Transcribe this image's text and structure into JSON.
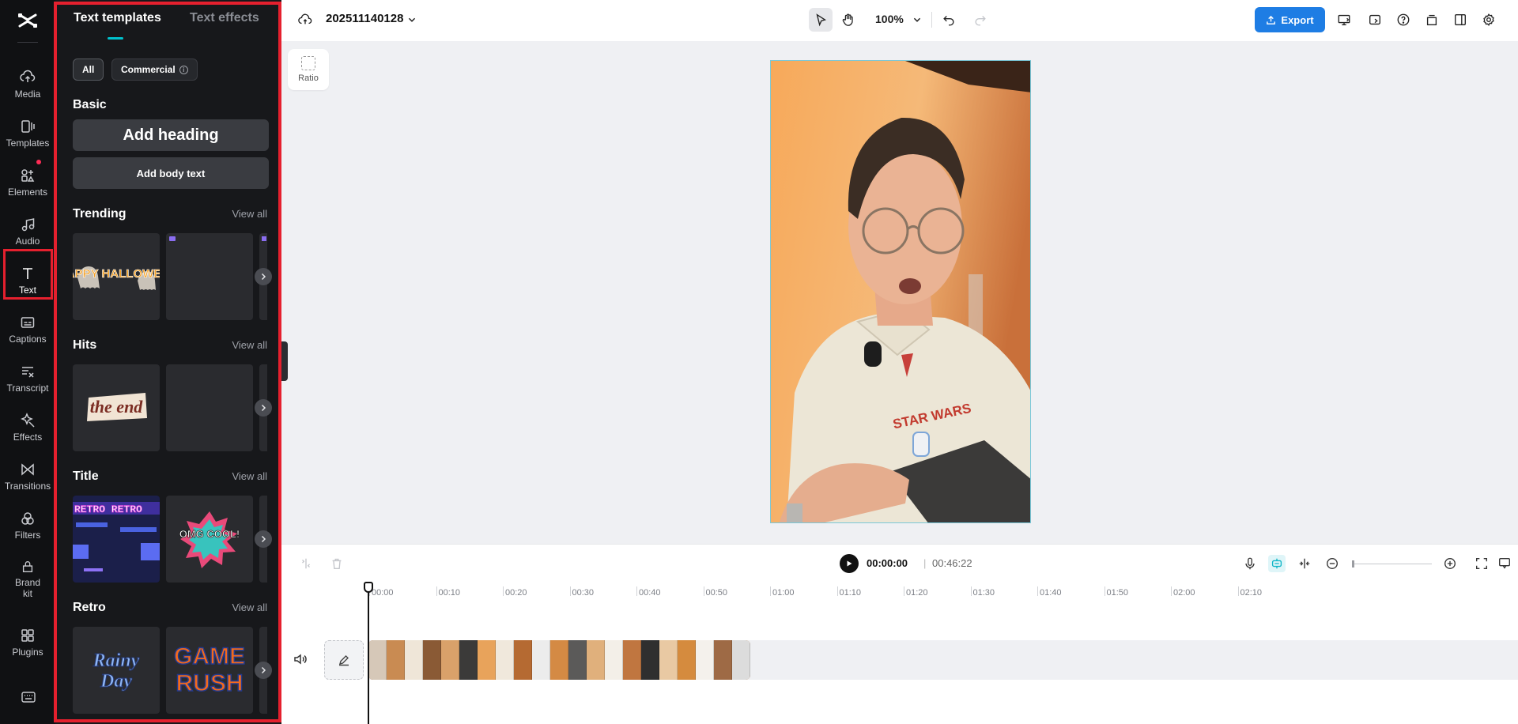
{
  "rail": {
    "items": [
      {
        "label": "Media",
        "icon": "cloud-upload-icon"
      },
      {
        "label": "Templates",
        "icon": "templates-icon"
      },
      {
        "label": "Elements",
        "icon": "elements-icon"
      },
      {
        "label": "Audio",
        "icon": "music-note-icon"
      },
      {
        "label": "Text",
        "icon": "text-icon"
      },
      {
        "label": "Captions",
        "icon": "captions-icon"
      },
      {
        "label": "Transcript",
        "icon": "transcript-icon"
      },
      {
        "label": "Effects",
        "icon": "effects-icon"
      },
      {
        "label": "Transitions",
        "icon": "transitions-icon"
      },
      {
        "label": "Filters",
        "icon": "filters-icon"
      },
      {
        "label": "Brand kit",
        "icon": "brand-kit-icon"
      },
      {
        "label": "Plugins",
        "icon": "plugins-icon"
      }
    ],
    "active": "Text",
    "active_highlight_color": "#e5202e"
  },
  "panel": {
    "tabs": [
      {
        "label": "Text templates"
      },
      {
        "label": "Text effects"
      }
    ],
    "filters": {
      "all": "All",
      "commercial": "Commercial"
    },
    "basic": {
      "title": "Basic",
      "add_heading": "Add heading",
      "add_body": "Add body text"
    },
    "sections": [
      {
        "title": "Trending",
        "view_all": "View all",
        "cards": [
          "HAPPY HALLOWEEN",
          ""
        ]
      },
      {
        "title": "Hits",
        "view_all": "View all",
        "cards": [
          "the end",
          ""
        ]
      },
      {
        "title": "Title",
        "view_all": "View all",
        "cards": [
          "RETRO RETRO",
          "OMG COOL!"
        ]
      },
      {
        "title": "Retro",
        "view_all": "View all",
        "cards": [
          "Rainy Day",
          "GAME RUSH"
        ]
      }
    ]
  },
  "topbar": {
    "project_name": "202511140128",
    "zoom": "100%",
    "export_label": "Export",
    "accent_color": "#1e7de4"
  },
  "canvas": {
    "ratio_label": "Ratio",
    "video_text": "STAR WARS"
  },
  "timeline": {
    "current_time": "00:00:00",
    "separator": "|",
    "total_time": "00:46:22",
    "ruler": [
      "00:00",
      "00:10",
      "00:20",
      "00:30",
      "00:40",
      "00:50",
      "01:00",
      "01:10",
      "01:20",
      "01:30",
      "01:40",
      "01:50",
      "02:00",
      "02:10"
    ]
  }
}
